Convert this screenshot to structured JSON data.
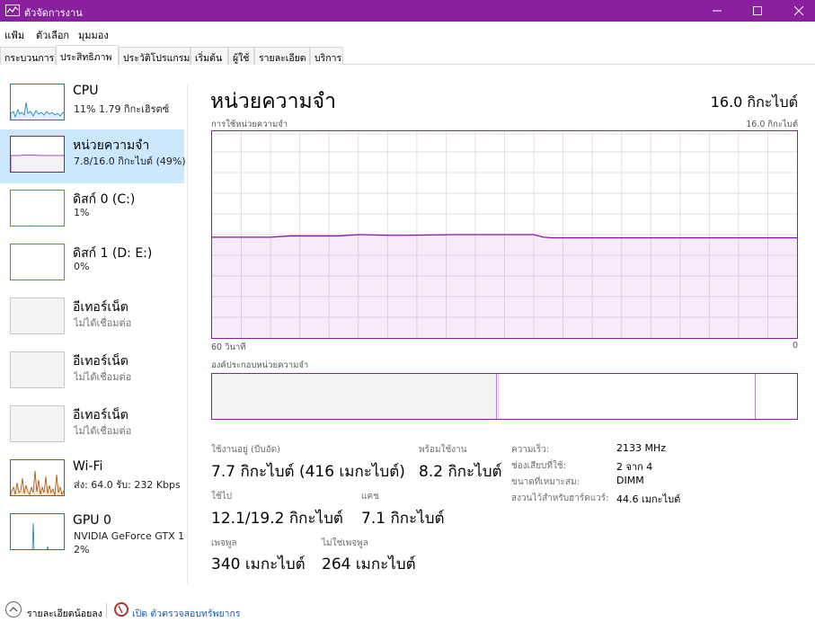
{
  "window": {
    "title": "ตัวจัดการงาน"
  },
  "menu": [
    "แฟ้ม",
    "ตัวเลือก",
    "มุมมอง"
  ],
  "tabs": [
    "กระบวนการ",
    "ประสิทธิภาพ",
    "ประวัติโปรแกรม",
    "เริ่มต้น",
    "ผู้ใช้",
    "รายละเอียด",
    "บริการ"
  ],
  "active_tab": "ประสิทธิภาพ",
  "sidebar": {
    "items": [
      {
        "title": "CPU",
        "sub": "11% 1.79 กิกะเฮิรตซ์",
        "color": "#117dbb"
      },
      {
        "title": "หน่วยความจำ",
        "sub": "7.8/16.0 กิกะไบต์ (49%)",
        "color": "#8b12ae",
        "selected": true
      },
      {
        "title": "ดิสก์ 0 (C:)",
        "sub": "1%",
        "color": "#4da60c"
      },
      {
        "title": "ดิสก์ 1 (D: E:)",
        "sub": "0%",
        "color": "#4da60c"
      },
      {
        "title": "อีเทอร์เน็ต",
        "sub": "ไม่ได้เชื่อมต่อ",
        "color": "#c8c8c8"
      },
      {
        "title": "อีเทอร์เน็ต",
        "sub": "ไม่ได้เชื่อมต่อ",
        "color": "#c8c8c8"
      },
      {
        "title": "อีเทอร์เน็ต",
        "sub": "ไม่ได้เชื่อมต่อ",
        "color": "#c8c8c8"
      },
      {
        "title": "Wi-Fi",
        "sub": "ส่ง: 64.0 รับ: 232 Kbps",
        "color": "#a74f01"
      },
      {
        "title": "GPU 0",
        "sub": "NVIDIA GeForce GTX 1080",
        "sub2": "2%",
        "color": "#117dbb"
      }
    ]
  },
  "main": {
    "title": "หน่วยความจำ",
    "total": "16.0 กิกะไบต์",
    "usage_label": "การใช้หน่วยความจำ",
    "usage_max": "16.0 กิกะไบต์",
    "time_left": "60 วินาที",
    "time_right": "0",
    "composition_label": "องค์ประกอบหน่วยความจำ",
    "color": "#8b12ae"
  },
  "chart_data": {
    "type": "area",
    "title": "การใช้หน่วยความจำ",
    "xlabel": "",
    "ylabel": "",
    "ylim": [
      0,
      16.0
    ],
    "x": [
      60,
      54,
      52,
      47,
      45,
      42,
      40,
      35,
      30,
      27,
      26,
      25,
      20,
      15,
      10,
      5,
      0
    ],
    "values": [
      7.8,
      7.8,
      7.9,
      7.9,
      8.0,
      7.95,
      7.95,
      8.0,
      8.0,
      8.0,
      7.8,
      7.75,
      7.75,
      7.75,
      7.75,
      7.75,
      7.75
    ]
  },
  "stats": {
    "in_use_label": "ใช้งานอยู่ (บีบอัด)",
    "in_use_value": "7.7 กิกะไบต์ (416 เมกะไบต์)",
    "available_label": "พร้อมใช้งาน",
    "available_value": "8.2 กิกะไบต์",
    "committed_label": "ใช้ไป",
    "committed_value": "12.1/19.2 กิกะไบต์",
    "cached_label": "แคช",
    "cached_value": "7.1 กิกะไบต์",
    "paged_label": "เพจพูล",
    "paged_value": "340 เมกะไบต์",
    "nonpaged_label": "ไม่ใช่เพจพูล",
    "nonpaged_value": "264 เมกะไบต์"
  },
  "details": [
    {
      "label": "ความเร็ว:",
      "value": "2133 MHz"
    },
    {
      "label": "ช่องเสียบที่ใช้:",
      "value": "2 จาก 4"
    },
    {
      "label": "ขนาดที่เหมาะสม:",
      "value": "DIMM"
    },
    {
      "label": "สงวนไว้สำหรับฮาร์ดแวร์:",
      "value": "44.6 เมกะไบต์"
    }
  ],
  "footer": {
    "fewer_details": "รายละเอียดน้อยลง",
    "open_monitor": "เปิด ตัวตรวจสอบทรัพยากร"
  }
}
